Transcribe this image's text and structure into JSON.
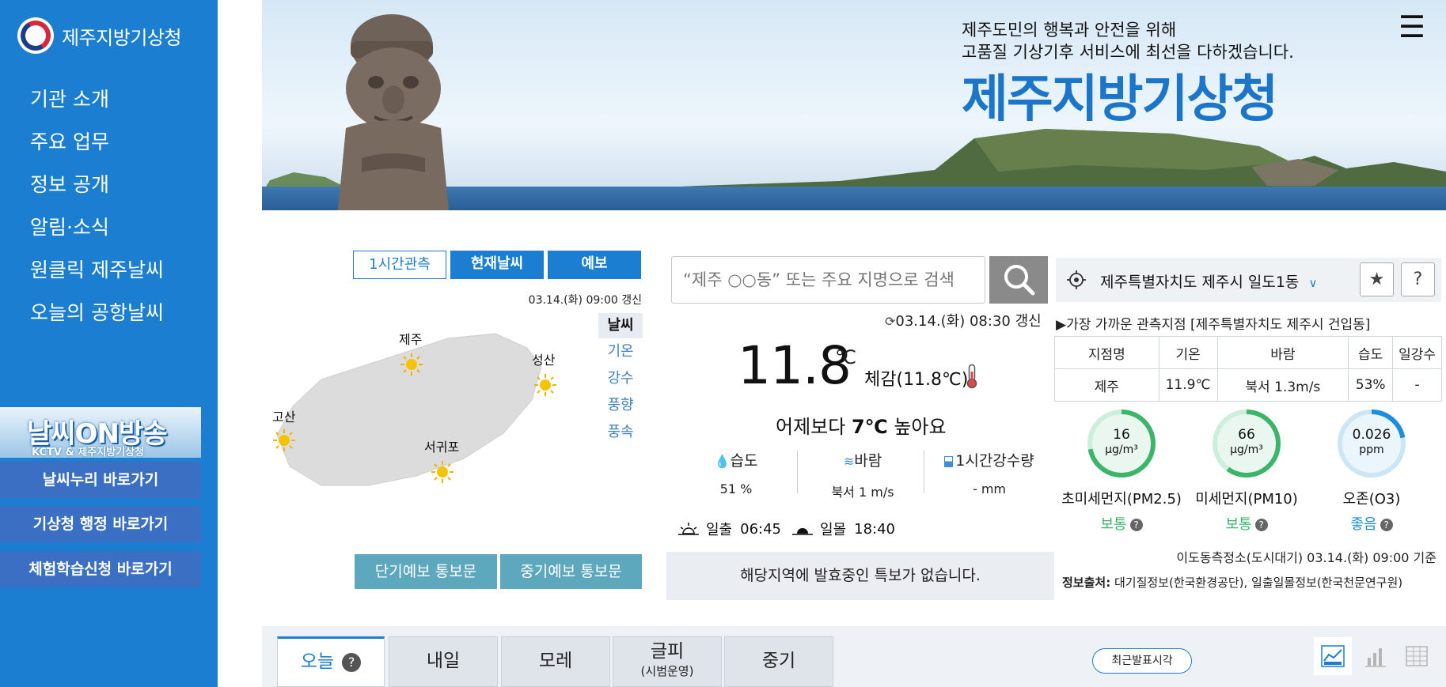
{
  "sidebar": {
    "logo_text": "제주지방기상청",
    "nav": [
      "기관 소개",
      "주요 업무",
      "정보 공개",
      "알림·소식",
      "원클릭 제주날씨",
      "오늘의 공항날씨"
    ],
    "promo_title": "날씨ON방송",
    "promo_sub": "KCTV & 제주지방기상청",
    "buttons": [
      "날씨누리 바로가기",
      "기상청 행정 바로가기",
      "체험학습신청 바로가기"
    ]
  },
  "banner": {
    "line1": "제주도민의 행복과 안전을 위해",
    "line2": "고품질 기상기후 서비스에 최선을 다하겠습니다.",
    "title": "제주지방기상청"
  },
  "map": {
    "tabs": [
      "1시간관측",
      "현재날씨",
      "예보"
    ],
    "time": "03.14.(화) 09:00 갱신",
    "side_tabs": [
      "날씨",
      "기온",
      "강수",
      "풍향",
      "풍속"
    ],
    "cities": [
      "제주",
      "성산",
      "고산",
      "서귀포"
    ],
    "buttons": [
      "단기예보 통보문",
      "중기예보 통보문"
    ]
  },
  "search": {
    "placeholder": "“제주 ○○동” 또는 주요 지명으로 검색"
  },
  "current": {
    "update": "03.14.(화) 08:30 갱신",
    "temp": "11.8",
    "unit": "℃",
    "feels": "체감(11.8℃)",
    "compare_pre": "어제보다 ",
    "compare_val": "7℃",
    "compare_post": " 높아요",
    "humidity_label": "습도",
    "humidity_val": "51 %",
    "wind_label": "바람",
    "wind_val": "북서 1 m/s",
    "rain_label": "1시간강수량",
    "rain_val": "- mm",
    "sunrise_label": "일출",
    "sunrise_time": "06:45",
    "sunset_label": "일몰",
    "sunset_time": "18:40",
    "alert": "해당지역에 발효중인 특보가 없습니다."
  },
  "location": {
    "name": "제주특별자치도 제주시 일도1동",
    "star": "★",
    "help": "?",
    "nearest": "▶가장 가까운 관측지점 [제주특별자치도 제주시 건입동]"
  },
  "obs_table": {
    "headers": [
      "지점명",
      "기온",
      "바람",
      "습도",
      "일강수"
    ],
    "row": [
      "제주",
      "11.9℃",
      "북서 1.3m/s",
      "53%",
      "-"
    ]
  },
  "air": [
    {
      "value": "16",
      "unit": "μg/m³",
      "name": "초미세먼지(PM2.5)",
      "status": "보통",
      "color": "#3cb56b",
      "fraction": 0.72
    },
    {
      "value": "66",
      "unit": "μg/m³",
      "name": "미세먼지(PM10)",
      "status": "보통",
      "color": "#3cb56b",
      "fraction": 0.6
    },
    {
      "value": "0.026",
      "unit": "ppm",
      "name": "오존(O3)",
      "status": "좋음",
      "color": "#1b8ee0",
      "fraction": 0.22
    }
  ],
  "air_basis": "이도동측정소(도시대기) 03.14.(화) 09:00 기준",
  "source_label": "정보출처:",
  "source_text": " 대기질정보(한국환경공단), 일출일몰정보(한국천문연구원)",
  "forecast": {
    "tabs": [
      "오늘",
      "내일",
      "모레",
      "글피",
      "중기"
    ],
    "tab_sub": "(시범운영)",
    "today_help": "?",
    "latest": "최근발표시각"
  },
  "colors": {
    "primary": "#1b7ed0",
    "map_button": "#5ea8be",
    "good": "#1b8ee0",
    "normal": "#3cb56b"
  }
}
